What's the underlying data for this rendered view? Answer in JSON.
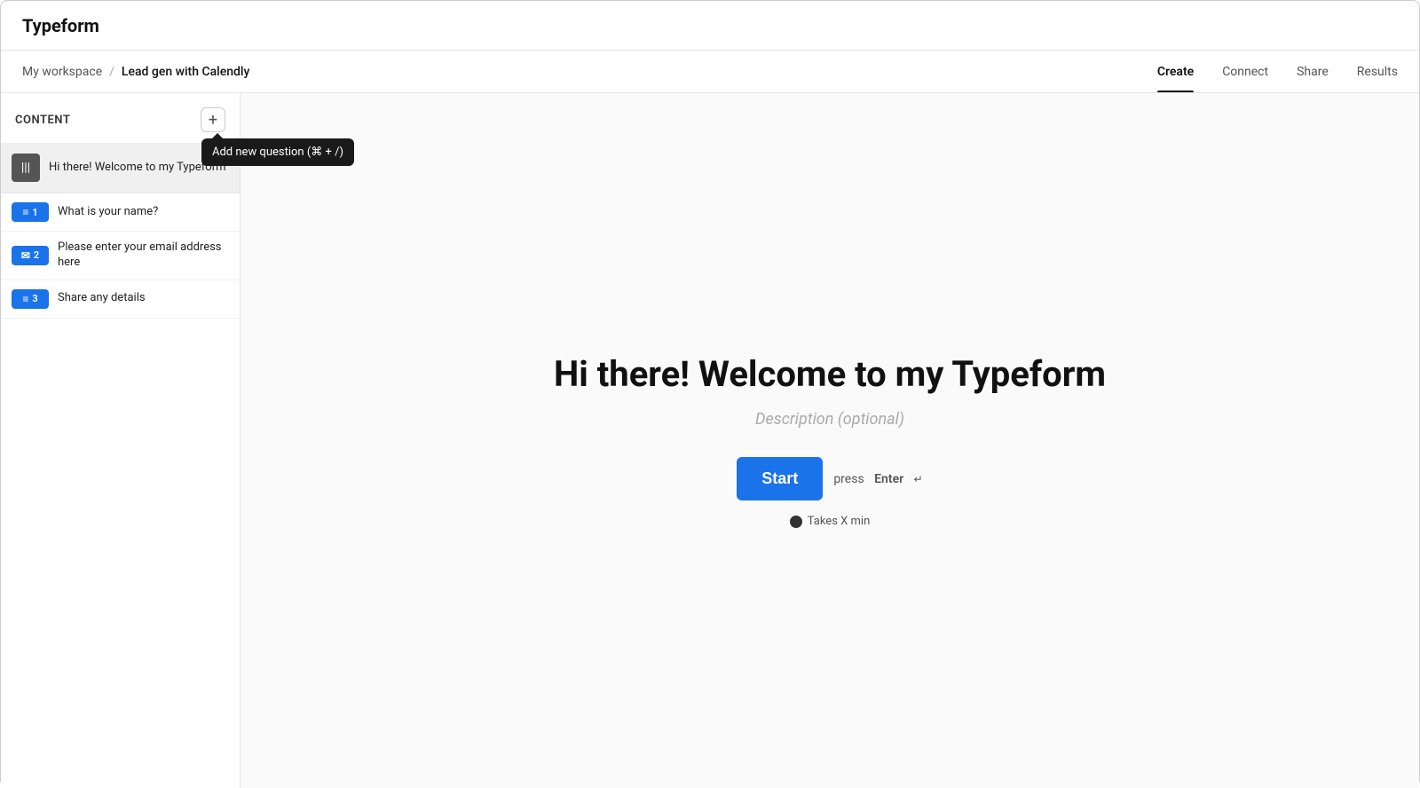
{
  "app": {
    "title": "Typeform"
  },
  "nav": {
    "workspace": "My workspace",
    "separator": "/",
    "form_name": "Lead gen with Calendly",
    "tabs": [
      {
        "label": "Create",
        "active": true
      },
      {
        "label": "Connect",
        "active": false
      },
      {
        "label": "Share",
        "active": false
      },
      {
        "label": "Results",
        "active": false
      }
    ]
  },
  "sidebar": {
    "title": "Content",
    "add_button_label": "+",
    "tooltip_label": "Add new question (⌘ + /)",
    "welcome_item": {
      "label": "Hi there! Welcome to my Typeform",
      "icon": "|||"
    },
    "questions": [
      {
        "number": "1",
        "icon": "≡",
        "label": "What is your name?"
      },
      {
        "number": "2",
        "icon": "✉",
        "label": "Please enter your email address here"
      },
      {
        "number": "3",
        "icon": "≡",
        "label": "Share any details"
      }
    ]
  },
  "preview": {
    "title": "Hi there! Welcome to my Typeform",
    "description": "Description (optional)",
    "start_button": "Start",
    "press_label": "press",
    "enter_label": "Enter",
    "enter_symbol": "↵",
    "takes_time": "Takes X min"
  }
}
